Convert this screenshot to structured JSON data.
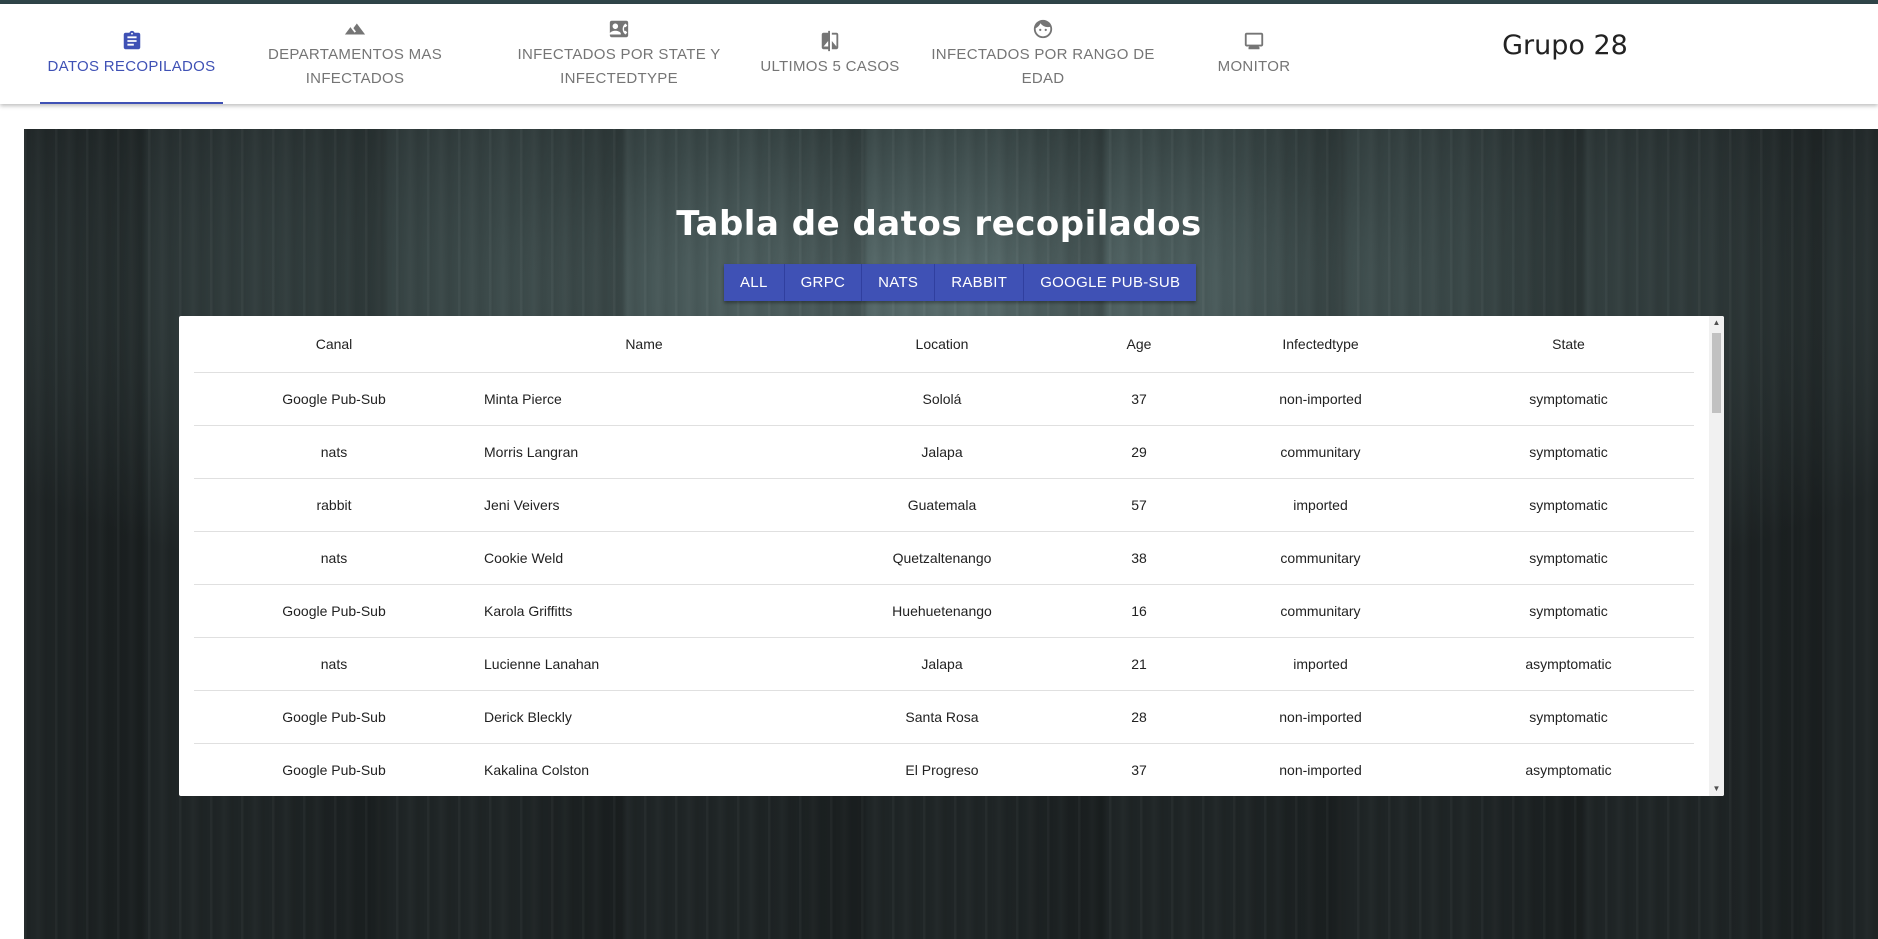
{
  "header": {
    "tabs": [
      {
        "label_line1": "Datos Recopilados",
        "label_line2": "",
        "icon": "clipboard-icon",
        "active": true
      },
      {
        "label_line1": "Departamentos mas",
        "label_line2": "infectados",
        "icon": "terrain-icon",
        "active": false
      },
      {
        "label_line1": "Infectados por State y",
        "label_line2": "Infectedtype",
        "icon": "contact-card-icon",
        "active": false
      },
      {
        "label_line1": "Ultimos 5 casos",
        "label_line2": "",
        "icon": "compare-icon",
        "active": false
      },
      {
        "label_line1": "Infectados por rango de",
        "label_line2": "edad",
        "icon": "face-icon",
        "active": false
      },
      {
        "label_line1": "Monitor",
        "label_line2": "",
        "icon": "monitor-icon",
        "active": false
      }
    ],
    "group_label": "Grupo 28"
  },
  "main": {
    "title": "Tabla de datos recopilados",
    "filters": [
      "All",
      "GRPC",
      "NATS",
      "RABBIT",
      "Google Pub-Sub"
    ]
  },
  "table": {
    "columns": [
      "Canal",
      "Name",
      "Location",
      "Age",
      "Infectedtype",
      "State"
    ],
    "rows": [
      {
        "canal": "Google Pub-Sub",
        "name": "Minta Pierce",
        "location": "Sololá",
        "age": "37",
        "infectedtype": "non-imported",
        "state": "symptomatic"
      },
      {
        "canal": "nats",
        "name": "Morris Langran",
        "location": "Jalapa",
        "age": "29",
        "infectedtype": "communitary",
        "state": "symptomatic"
      },
      {
        "canal": "rabbit",
        "name": "Jeni Veivers",
        "location": "Guatemala",
        "age": "57",
        "infectedtype": "imported",
        "state": "symptomatic"
      },
      {
        "canal": "nats",
        "name": "Cookie Weld",
        "location": "Quetzaltenango",
        "age": "38",
        "infectedtype": "communitary",
        "state": "symptomatic"
      },
      {
        "canal": "Google Pub-Sub",
        "name": "Karola Griffitts",
        "location": "Huehuetenango",
        "age": "16",
        "infectedtype": "communitary",
        "state": "symptomatic"
      },
      {
        "canal": "nats",
        "name": "Lucienne Lanahan",
        "location": "Jalapa",
        "age": "21",
        "infectedtype": "imported",
        "state": "asymptomatic"
      },
      {
        "canal": "Google Pub-Sub",
        "name": "Derick Bleckly",
        "location": "Santa Rosa",
        "age": "28",
        "infectedtype": "non-imported",
        "state": "symptomatic"
      },
      {
        "canal": "Google Pub-Sub",
        "name": "Kakalina Colston",
        "location": "El Progreso",
        "age": "37",
        "infectedtype": "non-imported",
        "state": "asymptomatic"
      }
    ]
  },
  "colors": {
    "accent": "#3f51b5",
    "inactive_tab": "#757575",
    "background_dark": "#2b3333"
  }
}
